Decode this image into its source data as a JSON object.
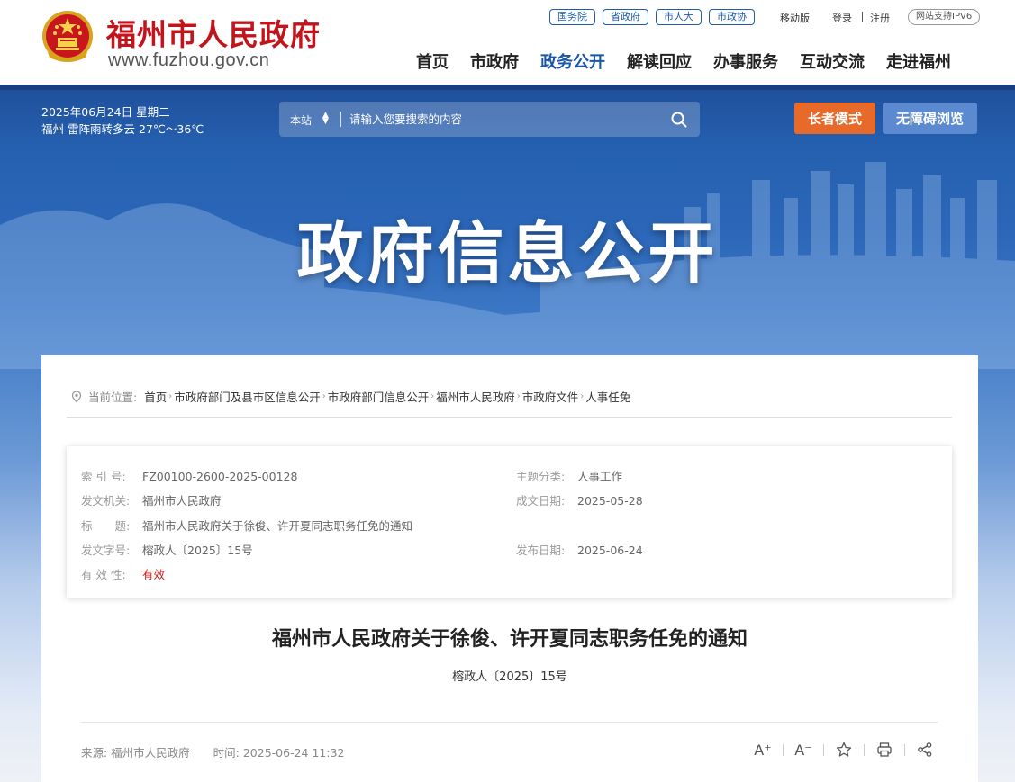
{
  "header": {
    "site_name": "福州市人民政府",
    "site_url": "www.fuzhou.gov.cn",
    "quick_links": [
      "国务院",
      "省政府",
      "市人大",
      "市政协"
    ],
    "mobile": "移动版",
    "login": "登录",
    "register": "注册",
    "ipv6": "网站支持IPV6",
    "nav": [
      "首页",
      "市政府",
      "政务公开",
      "解读回应",
      "办事服务",
      "互动交流",
      "走进福州"
    ],
    "active_nav": "政务公开"
  },
  "toolbar": {
    "date": "2025年06月24日 星期二",
    "weather": "福州 雷阵雨转多云 27℃～36℃",
    "search_scope": "本站",
    "search_placeholder": "请输入您要搜索的内容",
    "elder_mode": "长者模式",
    "accessible": "无障碍浏览"
  },
  "banner": {
    "title": "政府信息公开"
  },
  "breadcrumb": {
    "label": "当前位置:",
    "items": [
      "首页",
      "市政府部门及县市区信息公开",
      "市政府部门信息公开",
      "福州市人民政府",
      "市政府文件",
      "人事任免"
    ]
  },
  "meta": {
    "index_label": "索 引 号:",
    "index_value": "FZ00100-2600-2025-00128",
    "topic_label": "主题分类:",
    "topic_value": "人事工作",
    "issuer_label": "发文机关:",
    "issuer_value": "福州市人民政府",
    "written_label": "成文日期:",
    "written_value": "2025-05-28",
    "title_label": "标　　题:",
    "title_value": "福州市人民政府关于徐俊、许开夏同志职务任免的通知",
    "docno_label": "发文字号:",
    "docno_value": "榕政人〔2025〕15号",
    "published_label": "发布日期:",
    "published_value": "2025-06-24",
    "valid_label": "有 效 性:",
    "valid_value": "有效"
  },
  "document": {
    "title": "福州市人民政府关于徐俊、许开夏同志职务任免的通知",
    "number": "榕政人〔2025〕15号",
    "source": "来源: 福州市人民政府",
    "time": "时间: 2025-06-24 11:32"
  },
  "tools": {
    "font_larger": "A⁺",
    "font_smaller": "A⁻"
  },
  "colors": {
    "brand_red": "#c3141c",
    "nav_active": "#1a56a8",
    "banner_blue": "#2560b0",
    "elder_button": "#e86a2b",
    "accessible_button": "#5c8ad0",
    "valid_red": "#d71818"
  }
}
